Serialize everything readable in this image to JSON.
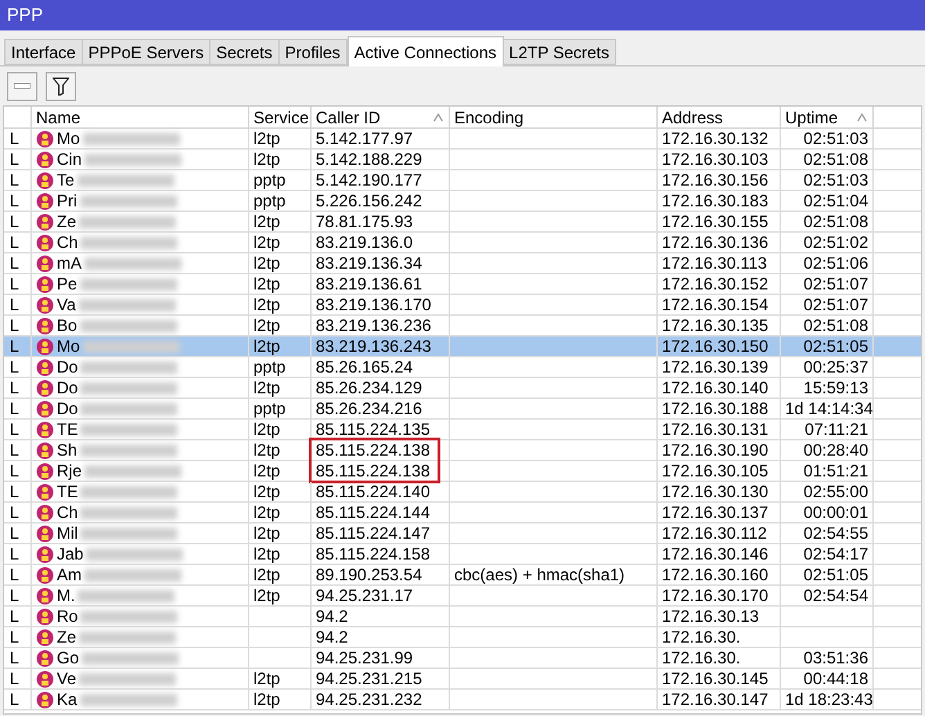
{
  "window": {
    "title": "PPP"
  },
  "tabs": [
    {
      "label": "Interface",
      "selected": false
    },
    {
      "label": "PPPoE Servers",
      "selected": false
    },
    {
      "label": "Secrets",
      "selected": false
    },
    {
      "label": "Profiles",
      "selected": false
    },
    {
      "label": "Active Connections",
      "selected": true
    },
    {
      "label": "L2TP Secrets",
      "selected": false
    }
  ],
  "table": {
    "columns": [
      {
        "label": "Name",
        "sorted": false
      },
      {
        "label": "Service",
        "sorted": false
      },
      {
        "label": "Caller ID",
        "sorted": true
      },
      {
        "label": "Encoding",
        "sorted": false
      },
      {
        "label": "Address",
        "sorted": false
      },
      {
        "label": "Uptime",
        "sorted": true
      }
    ],
    "rows": [
      {
        "flag": "L",
        "name": "Mo",
        "service": "l2tp",
        "caller_id": "5.142.177.97",
        "address": "172.16.30.132",
        "uptime": "02:51:03",
        "selected": false,
        "marked": false
      },
      {
        "flag": "L",
        "name": "Cin",
        "service": "l2tp",
        "caller_id": "5.142.188.229",
        "address": "172.16.30.103",
        "uptime": "02:51:08",
        "selected": false,
        "marked": false
      },
      {
        "flag": "L",
        "name": "Te",
        "service": "pptp",
        "caller_id": "5.142.190.177",
        "address": "172.16.30.156",
        "uptime": "02:51:03",
        "selected": false,
        "marked": false
      },
      {
        "flag": "L",
        "name": "Pri",
        "service": "pptp",
        "caller_id": "5.226.156.242",
        "address": "172.16.30.183",
        "uptime": "02:51:04",
        "selected": false,
        "marked": false
      },
      {
        "flag": "L",
        "name": "Ze",
        "service": "l2tp",
        "caller_id": "78.81.175.93",
        "address": "172.16.30.155",
        "uptime": "02:51:08",
        "selected": false,
        "marked": false
      },
      {
        "flag": "L",
        "name": "Ch",
        "service": "l2tp",
        "caller_id": "83.219.136.0",
        "address": "172.16.30.136",
        "uptime": "02:51:02",
        "selected": false,
        "marked": false
      },
      {
        "flag": "L",
        "name": "mA",
        "service": "l2tp",
        "caller_id": "83.219.136.34",
        "address": "172.16.30.113",
        "uptime": "02:51:06",
        "selected": false,
        "marked": false
      },
      {
        "flag": "L",
        "name": "Pe",
        "service": "l2tp",
        "caller_id": "83.219.136.61",
        "address": "172.16.30.152",
        "uptime": "02:51:07",
        "selected": false,
        "marked": false
      },
      {
        "flag": "L",
        "name": "Va",
        "service": "l2tp",
        "caller_id": "83.219.136.170",
        "address": "172.16.30.154",
        "uptime": "02:51:07",
        "selected": false,
        "marked": false
      },
      {
        "flag": "L",
        "name": "Bo",
        "service": "l2tp",
        "caller_id": "83.219.136.236",
        "address": "172.16.30.135",
        "uptime": "02:51:08",
        "selected": false,
        "marked": false
      },
      {
        "flag": "L",
        "name": "Mo",
        "service": "l2tp",
        "caller_id": "83.219.136.243",
        "address": "172.16.30.150",
        "uptime": "02:51:05",
        "selected": true,
        "marked": false
      },
      {
        "flag": "L",
        "name": "Do",
        "service": "pptp",
        "caller_id": "85.26.165.24",
        "address": "172.16.30.139",
        "uptime": "00:25:37",
        "selected": false,
        "marked": false
      },
      {
        "flag": "L",
        "name": "Do",
        "service": "l2tp",
        "caller_id": "85.26.234.129",
        "address": "172.16.30.140",
        "uptime": "15:59:13",
        "selected": false,
        "marked": false
      },
      {
        "flag": "L",
        "name": "Do",
        "service": "pptp",
        "caller_id": "85.26.234.216",
        "address": "172.16.30.188",
        "uptime": "1d 14:14:34",
        "selected": false,
        "marked": false
      },
      {
        "flag": "L",
        "name": "TE",
        "service": "l2tp",
        "caller_id": "85.115.224.135",
        "address": "172.16.30.131",
        "uptime": "07:11:21",
        "selected": false,
        "marked": false
      },
      {
        "flag": "L",
        "name": "Sh",
        "service": "l2tp",
        "caller_id": "85.115.224.138",
        "address": "172.16.30.190",
        "uptime": "00:28:40",
        "selected": false,
        "marked": true
      },
      {
        "flag": "L",
        "name": "Rje",
        "service": "l2tp",
        "caller_id": "85.115.224.138",
        "address": "172.16.30.105",
        "uptime": "01:51:21",
        "selected": false,
        "marked": true
      },
      {
        "flag": "L",
        "name": "TE",
        "service": "l2tp",
        "caller_id": "85.115.224.140",
        "address": "172.16.30.130",
        "uptime": "02:55:00",
        "selected": false,
        "marked": false
      },
      {
        "flag": "L",
        "name": "Ch",
        "service": "l2tp",
        "caller_id": "85.115.224.144",
        "address": "172.16.30.137",
        "uptime": "00:00:01",
        "selected": false,
        "marked": false
      },
      {
        "flag": "L",
        "name": "Mil",
        "service": "l2tp",
        "caller_id": "85.115.224.147",
        "address": "172.16.30.112",
        "uptime": "02:54:55",
        "selected": false,
        "marked": false
      },
      {
        "flag": "L",
        "name": "Jab",
        "service": "l2tp",
        "caller_id": "85.115.224.158",
        "address": "172.16.30.146",
        "uptime": "02:54:17",
        "selected": false,
        "marked": false
      },
      {
        "flag": "L",
        "name": "Am",
        "service": "l2tp",
        "caller_id": "89.190.253.54",
        "encoding": "cbc(aes) + hmac(sha1)",
        "address": "172.16.30.160",
        "uptime": "02:51:05",
        "selected": false,
        "marked": false
      },
      {
        "flag": "L",
        "name": "M.",
        "service": "l2tp",
        "caller_id": "94.25.231.17",
        "address": "172.16.30.170",
        "uptime": "02:54:54",
        "selected": false,
        "marked": false
      },
      {
        "flag": "L",
        "name": "Ro",
        "caller_id": "94.2",
        "address": "172.16.30.13",
        "selected": false,
        "marked": false
      },
      {
        "flag": "L",
        "name": "Ze",
        "caller_id": "94.2",
        "address": "172.16.30.",
        "selected": false,
        "marked": false
      },
      {
        "flag": "L",
        "name": "Go",
        "caller_id": "94.25.231.99",
        "address": "172.16.30.",
        "uptime": "03:51:36",
        "selected": false,
        "marked": false
      },
      {
        "flag": "L",
        "name": "Ve",
        "service": "l2tp",
        "caller_id": "94.25.231.215",
        "address": "172.16.30.145",
        "uptime": "00:44:18",
        "selected": false,
        "marked": false
      },
      {
        "flag": "L",
        "name": "Ka",
        "service": "l2tp",
        "caller_id": "94.25.231.232",
        "address": "172.16.30.147",
        "uptime": "1d 18:23:43",
        "selected": false,
        "marked": false
      }
    ]
  }
}
